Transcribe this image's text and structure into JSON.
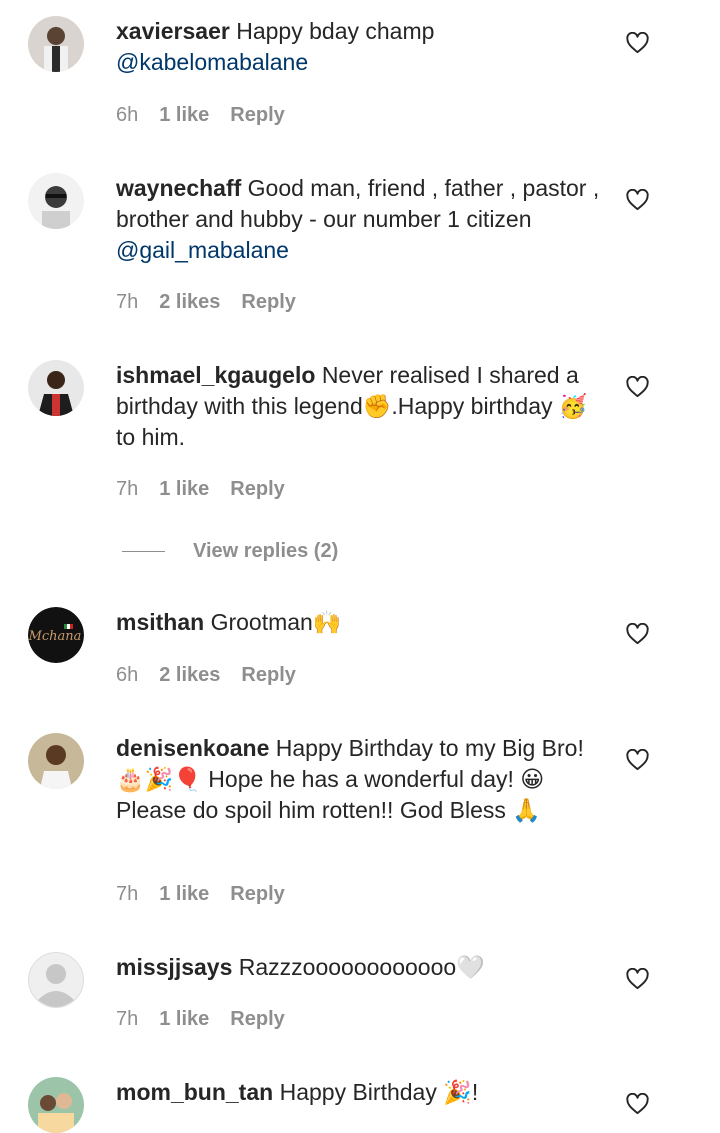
{
  "comments": [
    {
      "username": "xaviersaer",
      "text": "Happy bday champ",
      "mention": "@kabelomabalane",
      "time": "6h",
      "likes": "1 like",
      "reply": "Reply"
    },
    {
      "username": "waynechaff",
      "text": "Good man, friend , father , pastor , brother and hubby - our number 1 citizen",
      "mention": "@gail_mabalane",
      "time": "7h",
      "likes": "2 likes",
      "reply": "Reply"
    },
    {
      "username": "ishmael_kgaugelo",
      "text": "Never realised I shared a birthday with this legend✊.Happy birthday 🥳 to him.",
      "time": "7h",
      "likes": "1 like",
      "reply": "Reply"
    },
    {
      "username": "msithan",
      "text": "Grootman🙌",
      "time": "6h",
      "likes": "2 likes",
      "reply": "Reply"
    },
    {
      "username": "denisenkoane",
      "text_line1": "Happy Birthday to my Big Bro!",
      "text_line2": "🎂🎉🎈 Hope he has a wonderful day! 😀",
      "text_line3": "Please do spoil him rotten!! God Bless 🙏",
      "time": "7h",
      "likes": "1 like",
      "reply": "Reply"
    },
    {
      "username": "missjjsays",
      "text": "Razzzoooooooooooo🤍",
      "time": "7h",
      "likes": "1 like",
      "reply": "Reply"
    },
    {
      "username": "mom_bun_tan",
      "text": "Happy Birthday 🎉!"
    }
  ],
  "view_replies": "View replies (2)",
  "avatar_logo_text": "Mchana",
  "icons": {
    "heart": "heart-outline-icon"
  },
  "colors": {
    "text": "#262626",
    "secondary": "#8e8e8e",
    "mention": "#00376b"
  }
}
